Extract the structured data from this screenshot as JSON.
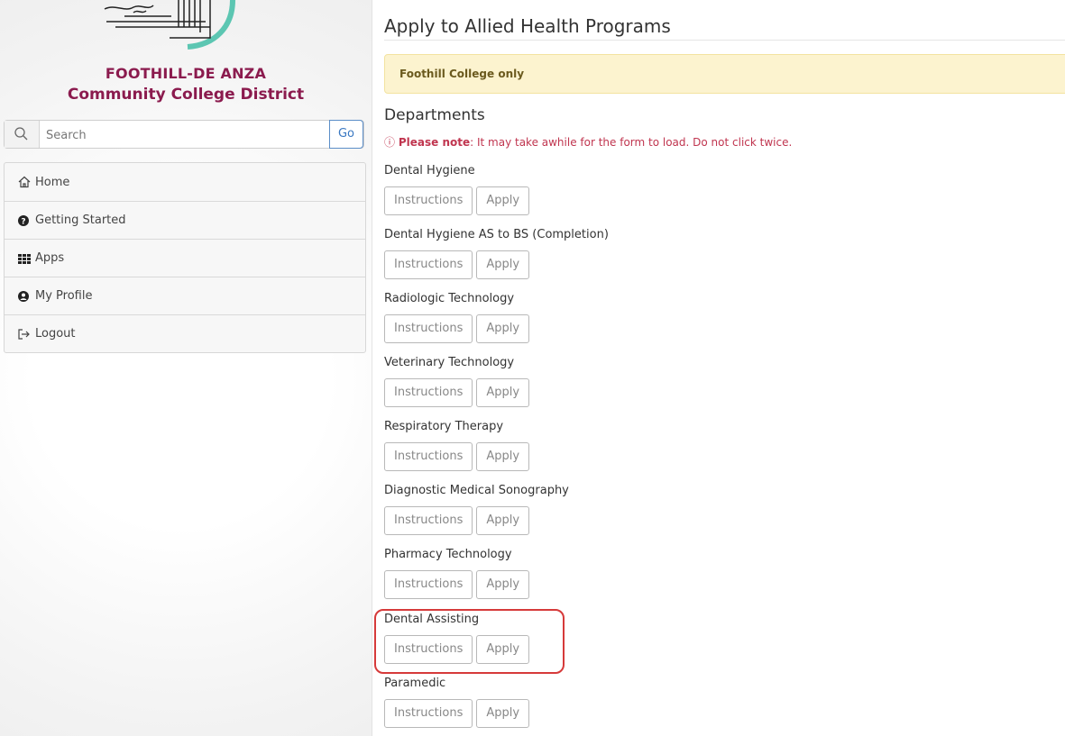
{
  "sidebar": {
    "logo": {
      "line1": "FOOTHILL-DE ANZA",
      "line2": "Community College District"
    },
    "search": {
      "placeholder": "Search",
      "go_label": "Go"
    },
    "nav": [
      {
        "label": "Home",
        "icon": "home-icon"
      },
      {
        "label": "Getting Started",
        "icon": "question-circle-icon"
      },
      {
        "label": "Apps",
        "icon": "grid-icon"
      },
      {
        "label": "My Profile",
        "icon": "user-circle-icon"
      },
      {
        "label": "Logout",
        "icon": "logout-icon"
      }
    ]
  },
  "main": {
    "title": "Apply to Allied Health Programs",
    "alert": "Foothill College only",
    "departments_heading": "Departments",
    "note": {
      "prefix": "Please note",
      "text": ": It may take awhile for the form to load. Do not click twice."
    },
    "departments": [
      {
        "name": "Dental Hygiene",
        "instructions_label": "Instructions",
        "apply_label": "Apply"
      },
      {
        "name": "Dental Hygiene AS to BS (Completion)",
        "instructions_label": "Instructions",
        "apply_label": "Apply"
      },
      {
        "name": "Radiologic Technology",
        "instructions_label": "Instructions",
        "apply_label": "Apply"
      },
      {
        "name": "Veterinary Technology",
        "instructions_label": "Instructions",
        "apply_label": "Apply"
      },
      {
        "name": "Respiratory Therapy",
        "instructions_label": "Instructions",
        "apply_label": "Apply"
      },
      {
        "name": "Diagnostic Medical Sonography",
        "instructions_label": "Instructions",
        "apply_label": "Apply"
      },
      {
        "name": "Pharmacy Technology",
        "instructions_label": "Instructions",
        "apply_label": "Apply"
      },
      {
        "name": "Dental Assisting",
        "instructions_label": "Instructions",
        "apply_label": "Apply",
        "highlighted": true
      },
      {
        "name": "Paramedic",
        "instructions_label": "Instructions",
        "apply_label": "Apply"
      }
    ]
  },
  "colors": {
    "brand": "#8b1b4e",
    "alert_bg": "#fcf3cf",
    "note": "#c0354f",
    "highlight": "#d63a3a",
    "go_button": "#3a78c2"
  }
}
